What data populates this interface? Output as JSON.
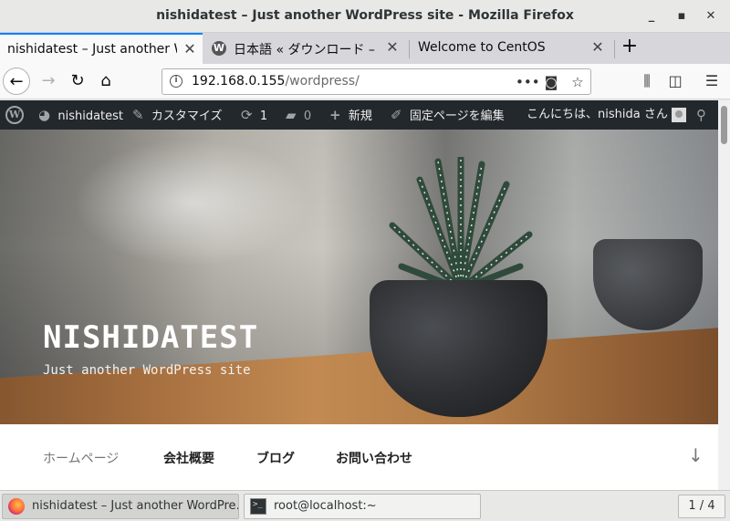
{
  "window": {
    "title": "nishidatest – Just another WordPress site - Mozilla Firefox"
  },
  "tabs": [
    {
      "label": "nishidatest – Just another Wo",
      "active": true
    },
    {
      "label": "日本語 « ダウンロード –",
      "active": false,
      "icon": "wordpress-icon"
    },
    {
      "label": "Welcome to CentOS",
      "active": false
    }
  ],
  "navbar": {
    "url_host": "192.168.0.155",
    "url_path": "/wordpress/"
  },
  "adminbar": {
    "site_name": "nishidatest",
    "customize": "カスタマイズ",
    "updates": "1",
    "comments": "0",
    "new": "新規",
    "edit_page": "固定ページを編集",
    "greeting": "こんにちは、nishida さん"
  },
  "hero": {
    "site_title": "NISHIDATEST",
    "tagline": "Just another WordPress site"
  },
  "site_nav": {
    "items": [
      "ホームページ",
      "会社概要",
      "ブログ",
      "お問い合わせ"
    ]
  },
  "taskbar": {
    "tasks": [
      {
        "label": "nishidatest – Just another WordPre…",
        "icon": "firefox-icon",
        "active": true
      },
      {
        "label": "root@localhost:~",
        "icon": "terminal-icon",
        "active": false
      }
    ],
    "pager": "1 / 4"
  },
  "colors": {
    "admin_bar": "#23282d",
    "tab_accent": "#0a84ff"
  }
}
